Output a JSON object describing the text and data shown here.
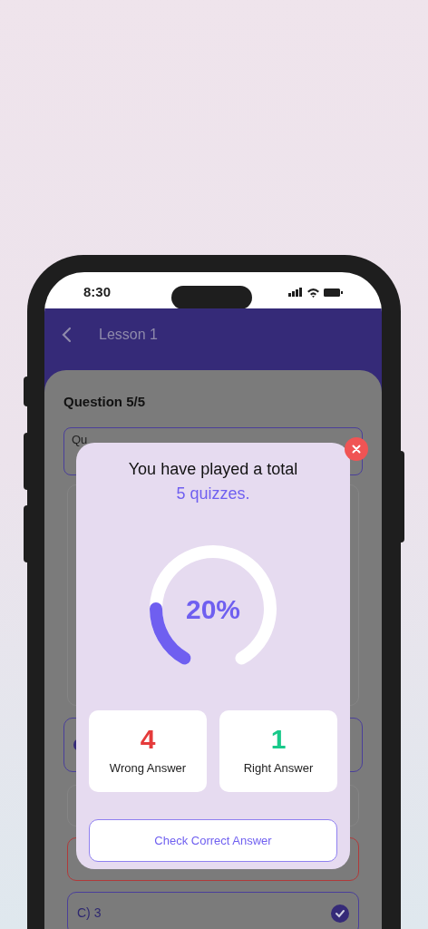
{
  "status_bar": {
    "time": "8:30"
  },
  "header": {
    "title": "Lesson 1"
  },
  "question": {
    "label": "Question 5/5",
    "field_text": "Qu"
  },
  "options": [
    {
      "kind": "selected"
    },
    {
      "kind": "plain"
    },
    {
      "kind": "wrong"
    },
    {
      "kind": "correct",
      "text": "C) 3"
    }
  ],
  "result_dialog": {
    "title": "You have played a total",
    "subtitle": "5 quizzes.",
    "progress": {
      "level": 0.2,
      "reading": "20%"
    },
    "stats": [
      {
        "value": "4",
        "label": "Wrong Answer",
        "color": "#e53b3b"
      },
      {
        "value": "1",
        "label": "Right Answer",
        "color": "#19c98a"
      }
    ],
    "button": "Check Correct Answer"
  }
}
